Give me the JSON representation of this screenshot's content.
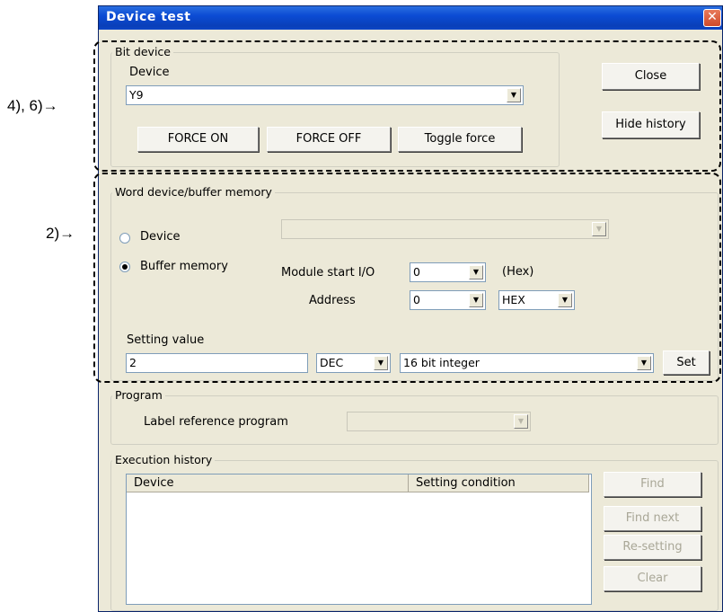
{
  "window": {
    "title": "Device test",
    "close_glyph": "✕"
  },
  "bit_device": {
    "legend": "Bit device",
    "device_label": "Device",
    "device_value": "Y9",
    "force_on_label": "FORCE ON",
    "force_off_label": "FORCE OFF",
    "toggle_force_label": "Toggle force"
  },
  "side_buttons": {
    "close_label": "Close",
    "hide_history_label": "Hide history"
  },
  "word_device": {
    "legend": "Word device/buffer memory",
    "device_radio_label": "Device",
    "device_value": "",
    "buffer_radio_label": "Buffer memory",
    "selected": "buffer_memory",
    "module_start_label": "Module start I/O",
    "module_start_value": "0",
    "hex_suffix": "(Hex)",
    "address_label": "Address",
    "address_value": "0",
    "address_format": "HEX",
    "setting_value_label": "Setting value",
    "setting_value": "2",
    "value_format": "DEC",
    "data_type": "16 bit integer",
    "set_label": "Set"
  },
  "program": {
    "legend": "Program",
    "label_ref_label": "Label reference program",
    "value": ""
  },
  "history": {
    "legend": "Execution history",
    "columns": [
      "Device",
      "Setting condition"
    ],
    "rows": [],
    "find_label": "Find",
    "find_next_label": "Find next",
    "resetting_label": "Re-setting",
    "clear_label": "Clear"
  },
  "callouts": {
    "bit": "4), 6)→",
    "word": "2)→"
  },
  "icons": {
    "dropdown": "dropdown-arrow-icon",
    "close": "close-icon"
  },
  "colors": {
    "title_bar": "#0b4bd4",
    "dialog_bg": "#ece9d8",
    "close_button": "#d04a2a",
    "disabled_text": "#a9a797"
  }
}
